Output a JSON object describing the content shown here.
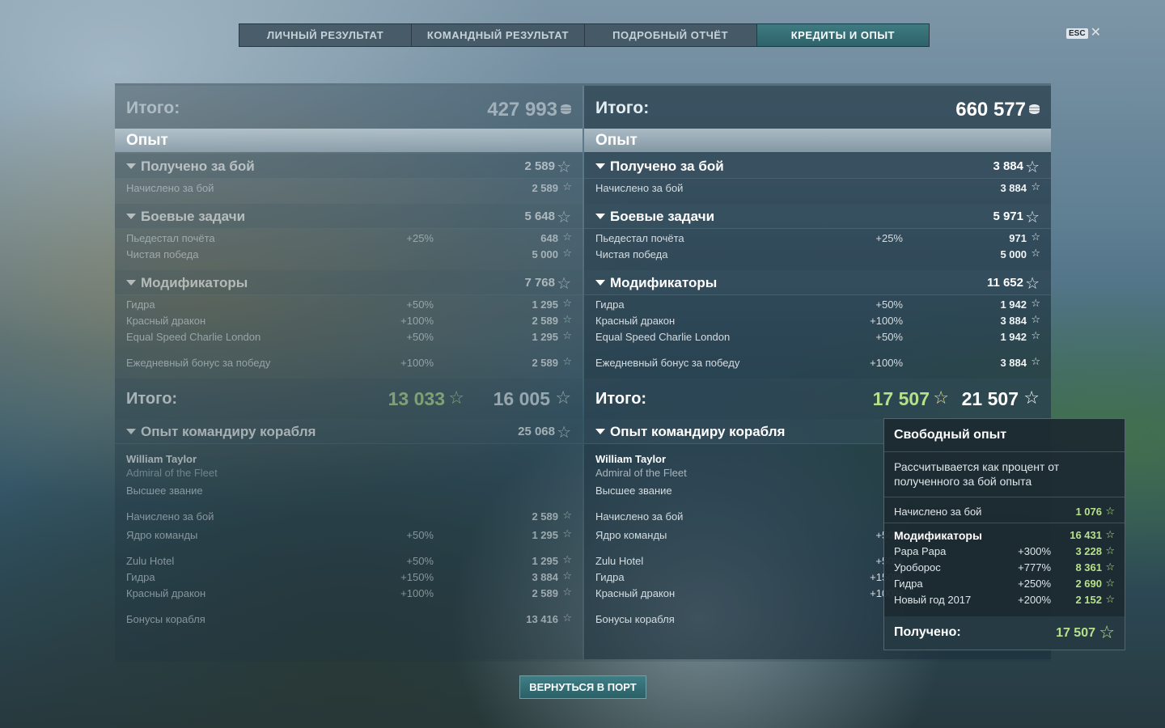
{
  "tabs": [
    {
      "label": "ЛИЧНЫЙ РЕЗУЛЬТАТ"
    },
    {
      "label": "КОМАНДНЫЙ РЕЗУЛЬТАТ"
    },
    {
      "label": "ПОДРОБНЫЙ ОТЧЁТ"
    },
    {
      "label": "КРЕДИТЫ И ОПЫТ"
    }
  ],
  "esc": {
    "key": "ESC",
    "close": "✕"
  },
  "star": "☆",
  "left": {
    "total_label": "Итого:",
    "total_value": "427 993",
    "section": "Опыт",
    "g1": {
      "label": "Получено за бой",
      "value": "2 589"
    },
    "g1_items": [
      {
        "label": "Начислено за бой",
        "pct": "",
        "value": "2 589"
      }
    ],
    "g2": {
      "label": "Боевые задачи",
      "value": "5 648"
    },
    "g2_items": [
      {
        "label": "Пьедестал почёта",
        "pct": "+25%",
        "value": "648"
      },
      {
        "label": "Чистая победа",
        "pct": "",
        "value": "5 000"
      }
    ],
    "g3": {
      "label": "Модификаторы",
      "value": "7 768"
    },
    "g3_items": [
      {
        "label": "Гидра",
        "pct": "+50%",
        "value": "1 295"
      },
      {
        "label": "Красный дракон",
        "pct": "+100%",
        "value": "2 589"
      },
      {
        "label": "Equal Speed Charlie London",
        "pct": "+50%",
        "value": "1 295"
      }
    ],
    "daily": {
      "label": "Ежедневный бонус за победу",
      "pct": "+100%",
      "value": "2 589"
    },
    "subtotal_label": "Итого:",
    "subtotal_a": "13 033",
    "subtotal_b": "16 005",
    "cmd_group": {
      "label": "Опыт командиру корабля",
      "value": "25 068"
    },
    "cmd_name": "William Taylor",
    "cmd_rank": "Admiral of the Fleet",
    "cmd_level": "Высшее звание",
    "cmd_items": [
      {
        "label": "Начислено за бой",
        "pct": "",
        "value": "2 589"
      },
      {
        "label": "Ядро команды",
        "pct": "+50%",
        "value": "1 295"
      },
      {
        "label": "Zulu Hotel",
        "pct": "+50%",
        "value": "1 295"
      },
      {
        "label": "Гидра",
        "pct": "+150%",
        "value": "3 884"
      },
      {
        "label": "Красный дракон",
        "pct": "+100%",
        "value": "2 589"
      },
      {
        "label": "Бонусы корабля",
        "pct": "",
        "value": "13 416"
      }
    ]
  },
  "right": {
    "total_label": "Итого:",
    "total_value": "660 577",
    "section": "Опыт",
    "g1": {
      "label": "Получено за бой",
      "value": "3 884"
    },
    "g1_items": [
      {
        "label": "Начислено за бой",
        "pct": "",
        "value": "3 884"
      }
    ],
    "g2": {
      "label": "Боевые задачи",
      "value": "5 971"
    },
    "g2_items": [
      {
        "label": "Пьедестал почёта",
        "pct": "+25%",
        "value": "971"
      },
      {
        "label": "Чистая победа",
        "pct": "",
        "value": "5 000"
      }
    ],
    "g3": {
      "label": "Модификаторы",
      "value": "11 652"
    },
    "g3_items": [
      {
        "label": "Гидра",
        "pct": "+50%",
        "value": "1 942"
      },
      {
        "label": "Красный дракон",
        "pct": "+100%",
        "value": "3 884"
      },
      {
        "label": "Equal Speed Charlie London",
        "pct": "+50%",
        "value": "1 942"
      }
    ],
    "daily": {
      "label": "Ежедневный бонус за победу",
      "pct": "+100%",
      "value": "3 884"
    },
    "subtotal_label": "Итого:",
    "subtotal_a": "17 507",
    "subtotal_b": "21 507",
    "cmd_group": {
      "label": "Опыт командиру корабля"
    },
    "cmd_name": "William Taylor",
    "cmd_rank": "Admiral of the Fleet",
    "cmd_level": "Высшее звание",
    "cmd_items": [
      {
        "label": "Начислено за бой",
        "pct": ""
      },
      {
        "label": "Ядро команды",
        "pct": "+50%"
      },
      {
        "label": "Zulu Hotel",
        "pct": "+50%"
      },
      {
        "label": "Гидра",
        "pct": "+150%"
      },
      {
        "label": "Красный дракон",
        "pct": "+100%"
      },
      {
        "label": "Бонусы корабля",
        "pct": ""
      }
    ]
  },
  "tooltip": {
    "title": "Свободный опыт",
    "desc": "Рассчитывается как процент от полученного за бой опыта",
    "earned": {
      "label": "Начислено за бой",
      "value": "1 076"
    },
    "mods": {
      "label": "Модификаторы",
      "value": "16 431"
    },
    "mod_items": [
      {
        "label": "Papa Papa",
        "pct": "+300%",
        "value": "3 228"
      },
      {
        "label": "Уроборос",
        "pct": "+777%",
        "value": "8 361"
      },
      {
        "label": "Гидра",
        "pct": "+250%",
        "value": "2 690"
      },
      {
        "label": "Новый год 2017",
        "pct": "+200%",
        "value": "2 152"
      }
    ],
    "footer": {
      "label": "Получено:",
      "value": "17 507"
    }
  },
  "back_button": "ВЕРНУТЬСЯ В ПОРТ",
  "colors": {
    "accent": "#2e6269",
    "green": "#b6e18a"
  }
}
